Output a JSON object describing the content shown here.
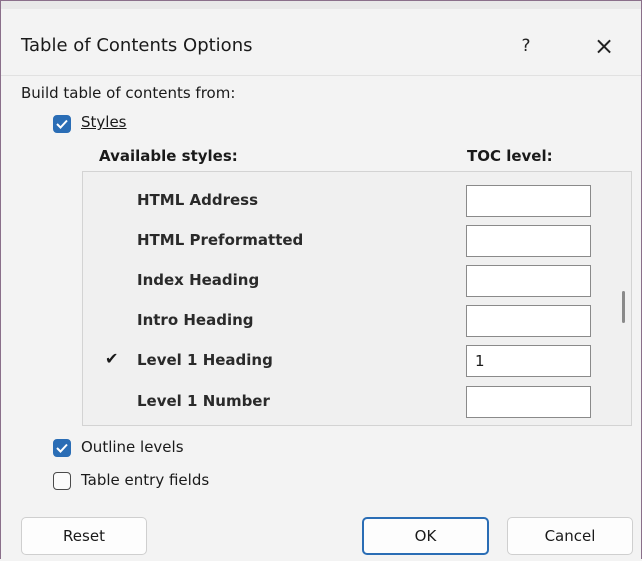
{
  "window": {
    "title": "Table of Contents Options",
    "help": "?",
    "close": "×"
  },
  "build_from_label": "Build table of contents from:",
  "styles_checkbox": {
    "label": "Styles",
    "checked": true
  },
  "available_styles_header": "Available styles:",
  "toc_level_header": "TOC level:",
  "styles_list": [
    {
      "name": "HTML Address",
      "level": "",
      "checked": false
    },
    {
      "name": "HTML Preformatted",
      "level": "",
      "checked": false
    },
    {
      "name": "Index Heading",
      "level": "",
      "checked": false
    },
    {
      "name": "Intro Heading",
      "level": "",
      "checked": false
    },
    {
      "name": "Level 1 Heading",
      "level": "1",
      "checked": true
    },
    {
      "name": "Level 1 Number",
      "level": "",
      "checked": false
    }
  ],
  "outline_levels_checkbox": {
    "label": "Outline levels",
    "checked": true
  },
  "table_entry_fields_checkbox": {
    "label": "Table entry fields",
    "checked": false
  },
  "buttons": {
    "reset": "Reset",
    "ok": "OK",
    "cancel": "Cancel"
  },
  "check_glyph": "✔",
  "colors": {
    "accent": "#2a6db5",
    "background": "#f3f3f3"
  }
}
